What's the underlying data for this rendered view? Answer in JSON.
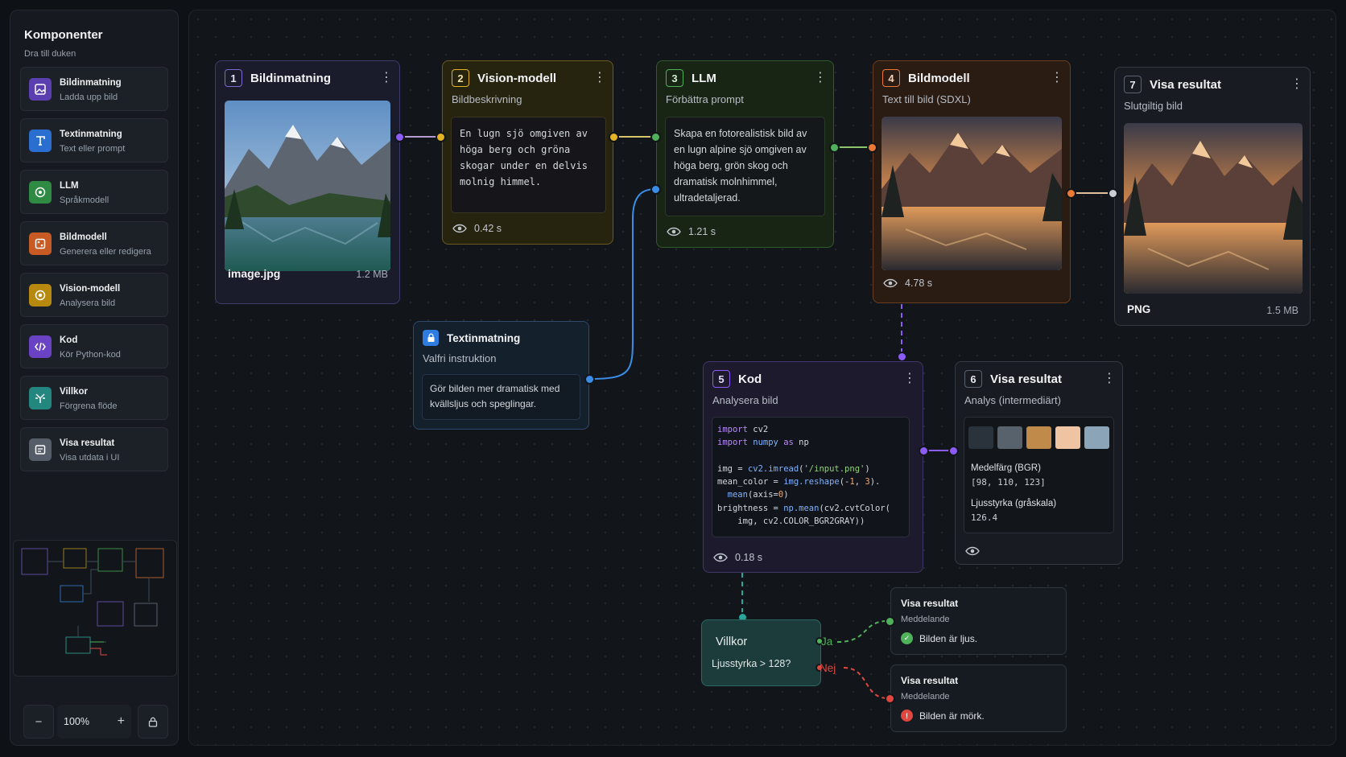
{
  "sidebar": {
    "title": "Komponenter",
    "subtitle": "Dra till duken",
    "items": [
      {
        "title": "Bildinmatning",
        "sub": "Ladda upp bild",
        "color": "#7a55d6",
        "icon": "image-icon"
      },
      {
        "title": "Textinmatning",
        "sub": "Text eller prompt",
        "color": "#2f7ce0",
        "icon": "text-icon"
      },
      {
        "title": "LLM",
        "sub": "Språkmodell",
        "color": "#3a9d4f",
        "icon": "llm-icon"
      },
      {
        "title": "Bildmodell",
        "sub": "Generera eller redigera",
        "color": "#d9672e",
        "icon": "palette-icon"
      },
      {
        "title": "Vision-modell",
        "sub": "Analysera bild",
        "color": "#c99a1c",
        "icon": "eye-icon"
      },
      {
        "title": "Kod",
        "sub": "Kör Python-kod",
        "color": "#7a4fd4",
        "icon": "code-icon"
      },
      {
        "title": "Villkor",
        "sub": "Förgrena flöde",
        "color": "#2e9e96",
        "icon": "branch-icon"
      },
      {
        "title": "Visa resultat",
        "sub": "Visa utdata i UI",
        "color": "#6a7280",
        "icon": "display-icon"
      }
    ],
    "zoom": "100%",
    "zoom_out": "−",
    "zoom_in": "+"
  },
  "nodes": {
    "n1": {
      "num": "1",
      "title": "Bildinmatning",
      "filename": "image.jpg",
      "size": "1.2 MB",
      "menu": "⋮"
    },
    "n2": {
      "num": "2",
      "title": "Vision-modell",
      "sub": "Bildbeskrivning",
      "text": "En lugn sjö omgiven av höga berg och gröna skogar under en delvis molnig himmel.",
      "time": "0.42 s",
      "menu": "⋮"
    },
    "n3": {
      "num": "3",
      "title": "LLM",
      "sub": "Förbättra prompt",
      "text": "Skapa en fotorealistisk bild av en lugn alpine sjö omgiven av höga berg, grön skog och dramatisk molnhimmel, ultradetaljerad.",
      "time": "1.21 s",
      "menu": "⋮"
    },
    "n4": {
      "num": "4",
      "title": "Bildmodell",
      "sub": "Text till bild (SDXL)",
      "time": "4.78 s",
      "menu": "⋮"
    },
    "n7": {
      "num": "7",
      "title": "Visa resultat",
      "sub": "Slutgiltig bild",
      "format": "PNG",
      "size": "1.5 MB",
      "menu": "⋮"
    },
    "text_input": {
      "title": "Textinmatning",
      "sub": "Valfri instruktion",
      "text": "Gör bilden mer dramatisk med kvällsljus och speglingar."
    },
    "n5": {
      "num": "5",
      "title": "Kod",
      "sub": "Analysera bild",
      "time": "0.18 s",
      "menu": "⋮"
    },
    "n6": {
      "num": "6",
      "title": "Visa resultat",
      "sub": "Analys (intermediärt)",
      "mean_label": "Medelfärg (BGR)",
      "mean_value": "[98, 110, 123]",
      "bright_label": "Ljusstyrka (gråskala)",
      "bright_value": "126.4",
      "menu": "⋮",
      "swatches": [
        "#2a323c",
        "#58626d",
        "#c08a4a",
        "#eec4a2",
        "#8ca4b8"
      ]
    },
    "cond": {
      "title": "Villkor",
      "expr": "Ljusstyrka > 128?",
      "yes": "Ja",
      "no": "Nej"
    },
    "msg_yes": {
      "title": "Visa resultat",
      "sub": "Meddelande",
      "text": "Bilden är ljus."
    },
    "msg_no": {
      "title": "Visa resultat",
      "sub": "Meddelande",
      "text": "Bilden är mörk."
    }
  },
  "colors": {
    "purple": "#8b5cf6",
    "yellow": "#e6b325",
    "green": "#4fb25a",
    "orange": "#ea7a35",
    "blue": "#3b8ee8",
    "teal": "#2aa59b",
    "red": "#e0483f"
  }
}
